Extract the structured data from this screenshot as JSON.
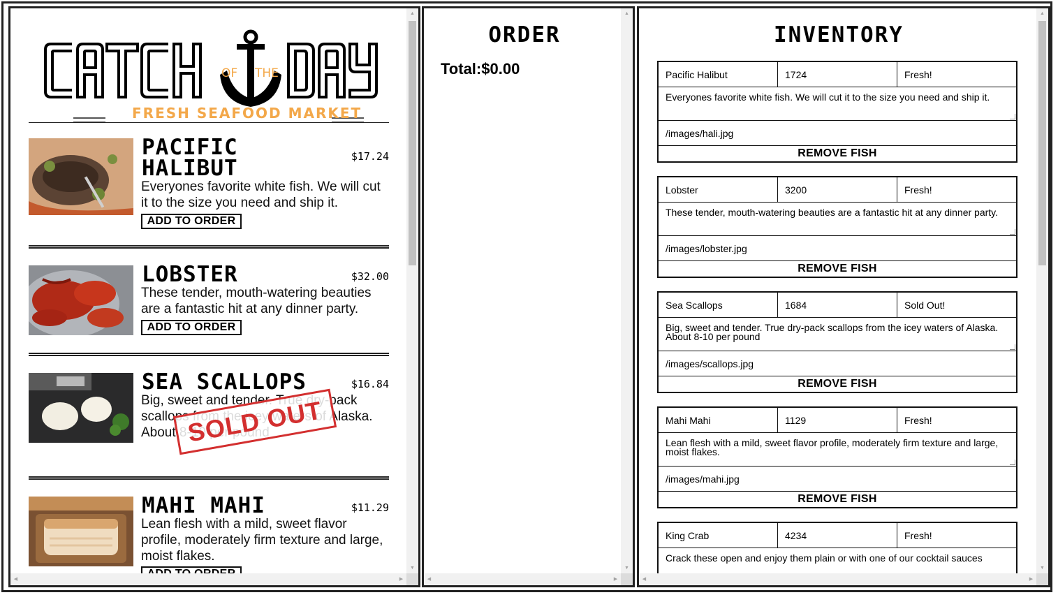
{
  "brand": {
    "word_left": "CATCH",
    "of": "OF",
    "the": "THE",
    "word_right": "DAY",
    "tagline": "FRESH SEAFOOD MARKET",
    "tagline_color": "#f3a84a"
  },
  "menu": {
    "add_label": "ADD TO ORDER",
    "sold_out_label": "SOLD OUT",
    "items": [
      {
        "name": "PACIFIC HALIBUT",
        "price": "$17.24",
        "desc": "Everyones favorite white fish. We will cut it to the size you need and ship it.",
        "status": "available"
      },
      {
        "name": "LOBSTER",
        "price": "$32.00",
        "desc": "These tender, mouth-watering beauties are a fantastic hit at any dinner party.",
        "status": "available"
      },
      {
        "name": "SEA SCALLOPS",
        "price": "$16.84",
        "desc": "Big, sweet and tender. True dry-pack scallops from the icey waters of Alaska. About 8-10 per pound",
        "status": "sold_out"
      },
      {
        "name": "MAHI MAHI",
        "price": "$11.29",
        "desc": "Lean flesh with a mild, sweet flavor profile, moderately firm texture and large, moist flakes.",
        "status": "available"
      }
    ]
  },
  "order": {
    "title": "ORDER",
    "total": "Total:$0.00"
  },
  "inventory": {
    "title": "INVENTORY",
    "remove_label": "REMOVE FISH",
    "items": [
      {
        "name": "Pacific Halibut",
        "price": "1724",
        "status": "Fresh!",
        "desc": "Everyones favorite white fish. We will cut it to the size you need and ship it.",
        "image": "/images/hali.jpg"
      },
      {
        "name": "Lobster",
        "price": "3200",
        "status": "Fresh!",
        "desc": "These tender, mouth-watering beauties are a fantastic hit at any dinner party.",
        "image": "/images/lobster.jpg"
      },
      {
        "name": "Sea Scallops",
        "price": "1684",
        "status": "Sold Out!",
        "desc": "Big, sweet and tender. True dry-pack scallops from the icey waters of Alaska. About 8-10 per pound",
        "image": "/images/scallops.jpg"
      },
      {
        "name": "Mahi Mahi",
        "price": "1129",
        "status": "Fresh!",
        "desc": "Lean flesh with a mild, sweet flavor profile, moderately firm texture and large, moist flakes.",
        "image": "/images/mahi.jpg"
      },
      {
        "name": "King Crab",
        "price": "4234",
        "status": "Fresh!",
        "desc": "Crack these open and enjoy them plain or with one of our cocktail sauces",
        "image": ""
      }
    ]
  },
  "colors": {
    "sold_out": "#d32f2f",
    "border": "#222222"
  }
}
